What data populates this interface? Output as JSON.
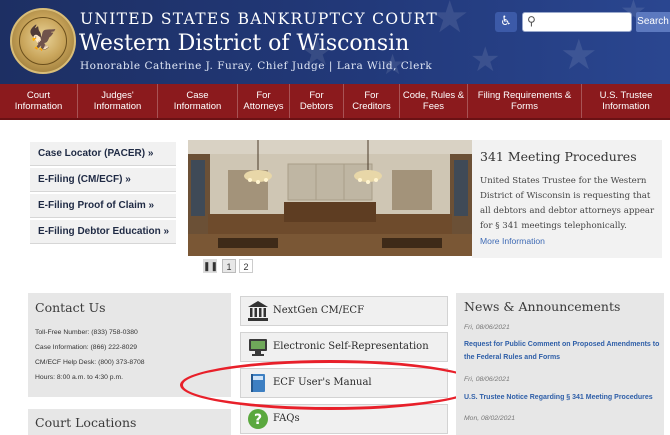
{
  "header": {
    "court_name": "UNITED STATES BANKRUPTCY COURT",
    "district_name": "Western District of Wisconsin",
    "judge_line": "Honorable Catherine J. Furay, Chief Judge | Lara Wild, Clerk",
    "search_button": "Search",
    "accessibility_icon": "accessibility-icon",
    "search_icon": "magnifier",
    "colors": {
      "header_bg": "#22397a",
      "nav_bg": "#8b1a1d",
      "link": "#2f5fa8"
    }
  },
  "nav": {
    "items": [
      "Court\nInformation",
      "Judges'\nInformation",
      "Case\nInformation",
      "For\nAttorneys",
      "For\nDebtors",
      "For\nCreditors",
      "Code, Rules &\nFees",
      "Filing Requirements &\nForms",
      "U.S. Trustee\nInformation"
    ]
  },
  "quick_links": [
    "Case Locator (PACER) »",
    "E-Filing (CM/ECF) »",
    "E-Filing Proof of Claim »",
    "E-Filing Debtor Education »"
  ],
  "slider": {
    "pause": "❚❚",
    "pages": [
      "1",
      "2"
    ],
    "active_page": 1
  },
  "announcement": {
    "title": "341 Meeting Procedures",
    "body": "United States Trustee for the Western District of Wisconsin is requesting that all debtors and debtor attorneys appear for § 341 meetings telephonically.",
    "more": "More Information"
  },
  "contact": {
    "title": "Contact Us",
    "lines": [
      "Toll-Free Number: (833) 758-0380",
      "Case Information: (866) 222-8029",
      "CM/ECF Help Desk: (800) 373-8708",
      "Hours: 8:00 a.m. to 4:30 p.m."
    ]
  },
  "court_locations": {
    "title": "Court Locations"
  },
  "resources": [
    {
      "label": "NextGen CM/ECF",
      "icon": "courthouse-icon"
    },
    {
      "label": "Electronic Self-Representation",
      "icon": "computer-icon"
    },
    {
      "label": "ECF User's Manual",
      "icon": "manual-book-icon"
    },
    {
      "label": "FAQs",
      "icon": "question-icon"
    }
  ],
  "news": {
    "title": "News & Announcements",
    "items": [
      {
        "date": "Fri, 08/06/2021",
        "headline": "Request for Public Comment on Proposed Amendments to the Federal Rules and Forms"
      },
      {
        "date": "Fri, 08/06/2021",
        "headline": "U.S. Trustee Notice Regarding § 341 Meeting Procedures"
      },
      {
        "date": "Mon, 08/02/2021",
        "headline": ""
      }
    ]
  }
}
